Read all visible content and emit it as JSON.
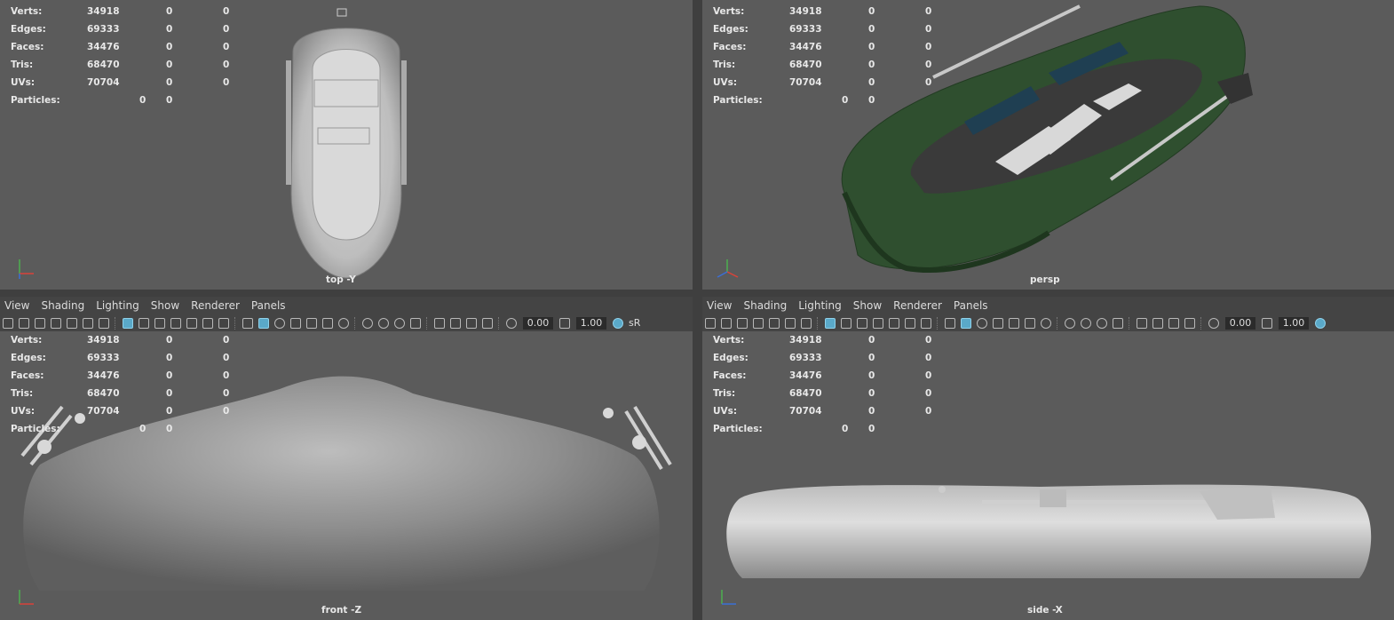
{
  "hud": {
    "labels": {
      "verts": "Verts:",
      "edges": "Edges:",
      "faces": "Faces:",
      "tris": "Tris:",
      "uvs": "UVs:",
      "particles": "Particles:"
    },
    "values": {
      "verts": [
        "34918",
        "0",
        "0"
      ],
      "edges": [
        "69333",
        "0",
        "0"
      ],
      "faces": [
        "34476",
        "0",
        "0"
      ],
      "tris": [
        "68470",
        "0",
        "0"
      ],
      "uvs": [
        "70704",
        "0",
        "0"
      ],
      "particles": [
        "0",
        "0"
      ]
    }
  },
  "viewports": {
    "top": {
      "camera": "top -Y"
    },
    "persp": {
      "camera": "persp"
    },
    "front": {
      "camera": "front -Z"
    },
    "side": {
      "camera": "side -X"
    }
  },
  "menu": [
    "View",
    "Shading",
    "Lighting",
    "Show",
    "Renderer",
    "Panels"
  ],
  "toolbar": {
    "exposure": "0.00",
    "gamma": "1.00",
    "colorspace": "sR"
  },
  "axis": {
    "y": "y",
    "x": "x",
    "z": "z"
  },
  "colors": {
    "viewport": "#5b5b5b",
    "boat_green": "#2f4f2f",
    "highlight": "#5aa9c9"
  }
}
